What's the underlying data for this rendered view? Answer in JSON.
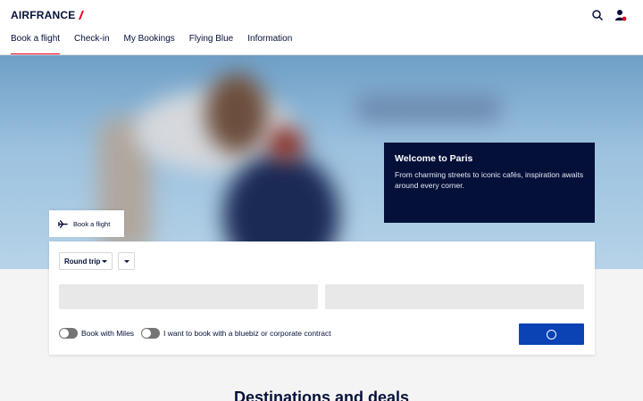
{
  "header": {
    "brand": "AIRFRANCE",
    "search_icon": "search-icon",
    "account_icon": "account-icon",
    "nav": [
      {
        "label": "Book a flight",
        "active": true
      },
      {
        "label": "Check-in"
      },
      {
        "label": "My Bookings"
      },
      {
        "label": "Flying Blue"
      },
      {
        "label": "Information"
      }
    ]
  },
  "hero": {
    "title": "Welcome to Paris",
    "text": "From charming streets to iconic cafés, inspiration awaits around every corner."
  },
  "booking": {
    "tab_label": "Book a flight",
    "tab_icon": "plane-icon",
    "trip_type": "Round trip",
    "toggles": [
      "Book with Miles",
      "I want to book with a bluebiz or corporate contract"
    ],
    "search_state": "loading"
  },
  "section": {
    "title": "Destinations and deals"
  },
  "colors": {
    "navy": "#051039",
    "accent_red": "#e1001f",
    "button_blue": "#0b43b5"
  }
}
